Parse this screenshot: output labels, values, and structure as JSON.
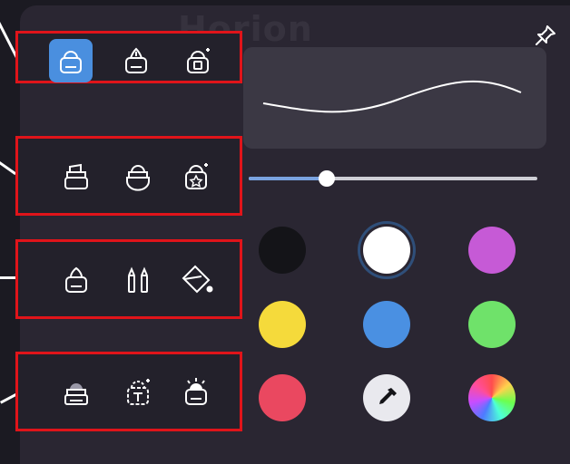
{
  "app": {
    "watermark": "Horion"
  },
  "toolbar_icons": {
    "pin": "pin-icon"
  },
  "slider": {
    "value_fraction": 0.27
  },
  "tool_groups": [
    {
      "tools": [
        {
          "icon": "marker-icon",
          "active": true
        },
        {
          "icon": "pen-icon",
          "active": false
        },
        {
          "icon": "pencil-icon",
          "active": false
        }
      ]
    },
    {
      "tools": [
        {
          "icon": "highlighter-icon",
          "active": false
        },
        {
          "icon": "brush-icon",
          "active": false
        },
        {
          "icon": "magic-pen-icon",
          "active": false
        }
      ]
    },
    {
      "tools": [
        {
          "icon": "chalk-icon",
          "active": false
        },
        {
          "icon": "crayon-icon",
          "active": false
        },
        {
          "icon": "fill-bucket-icon",
          "active": false
        }
      ]
    },
    {
      "tools": [
        {
          "icon": "stamp-icon",
          "active": false
        },
        {
          "icon": "text-marker-icon",
          "active": false
        },
        {
          "icon": "glow-pen-icon",
          "active": false
        }
      ]
    }
  ],
  "colors": [
    {
      "name": "black",
      "hex": "#141418"
    },
    {
      "name": "white",
      "hex": "#ffffff",
      "selected": true
    },
    {
      "name": "purple",
      "hex": "#c65ad6"
    },
    {
      "name": "yellow",
      "hex": "#f5da3b"
    },
    {
      "name": "blue",
      "hex": "#4a90e2"
    },
    {
      "name": "green",
      "hex": "#6fe26a"
    },
    {
      "name": "red",
      "hex": "#ea4860"
    },
    {
      "name": "eyedropper",
      "icon": "eyedropper-icon"
    },
    {
      "name": "rainbow",
      "icon": "color-wheel-icon"
    }
  ]
}
